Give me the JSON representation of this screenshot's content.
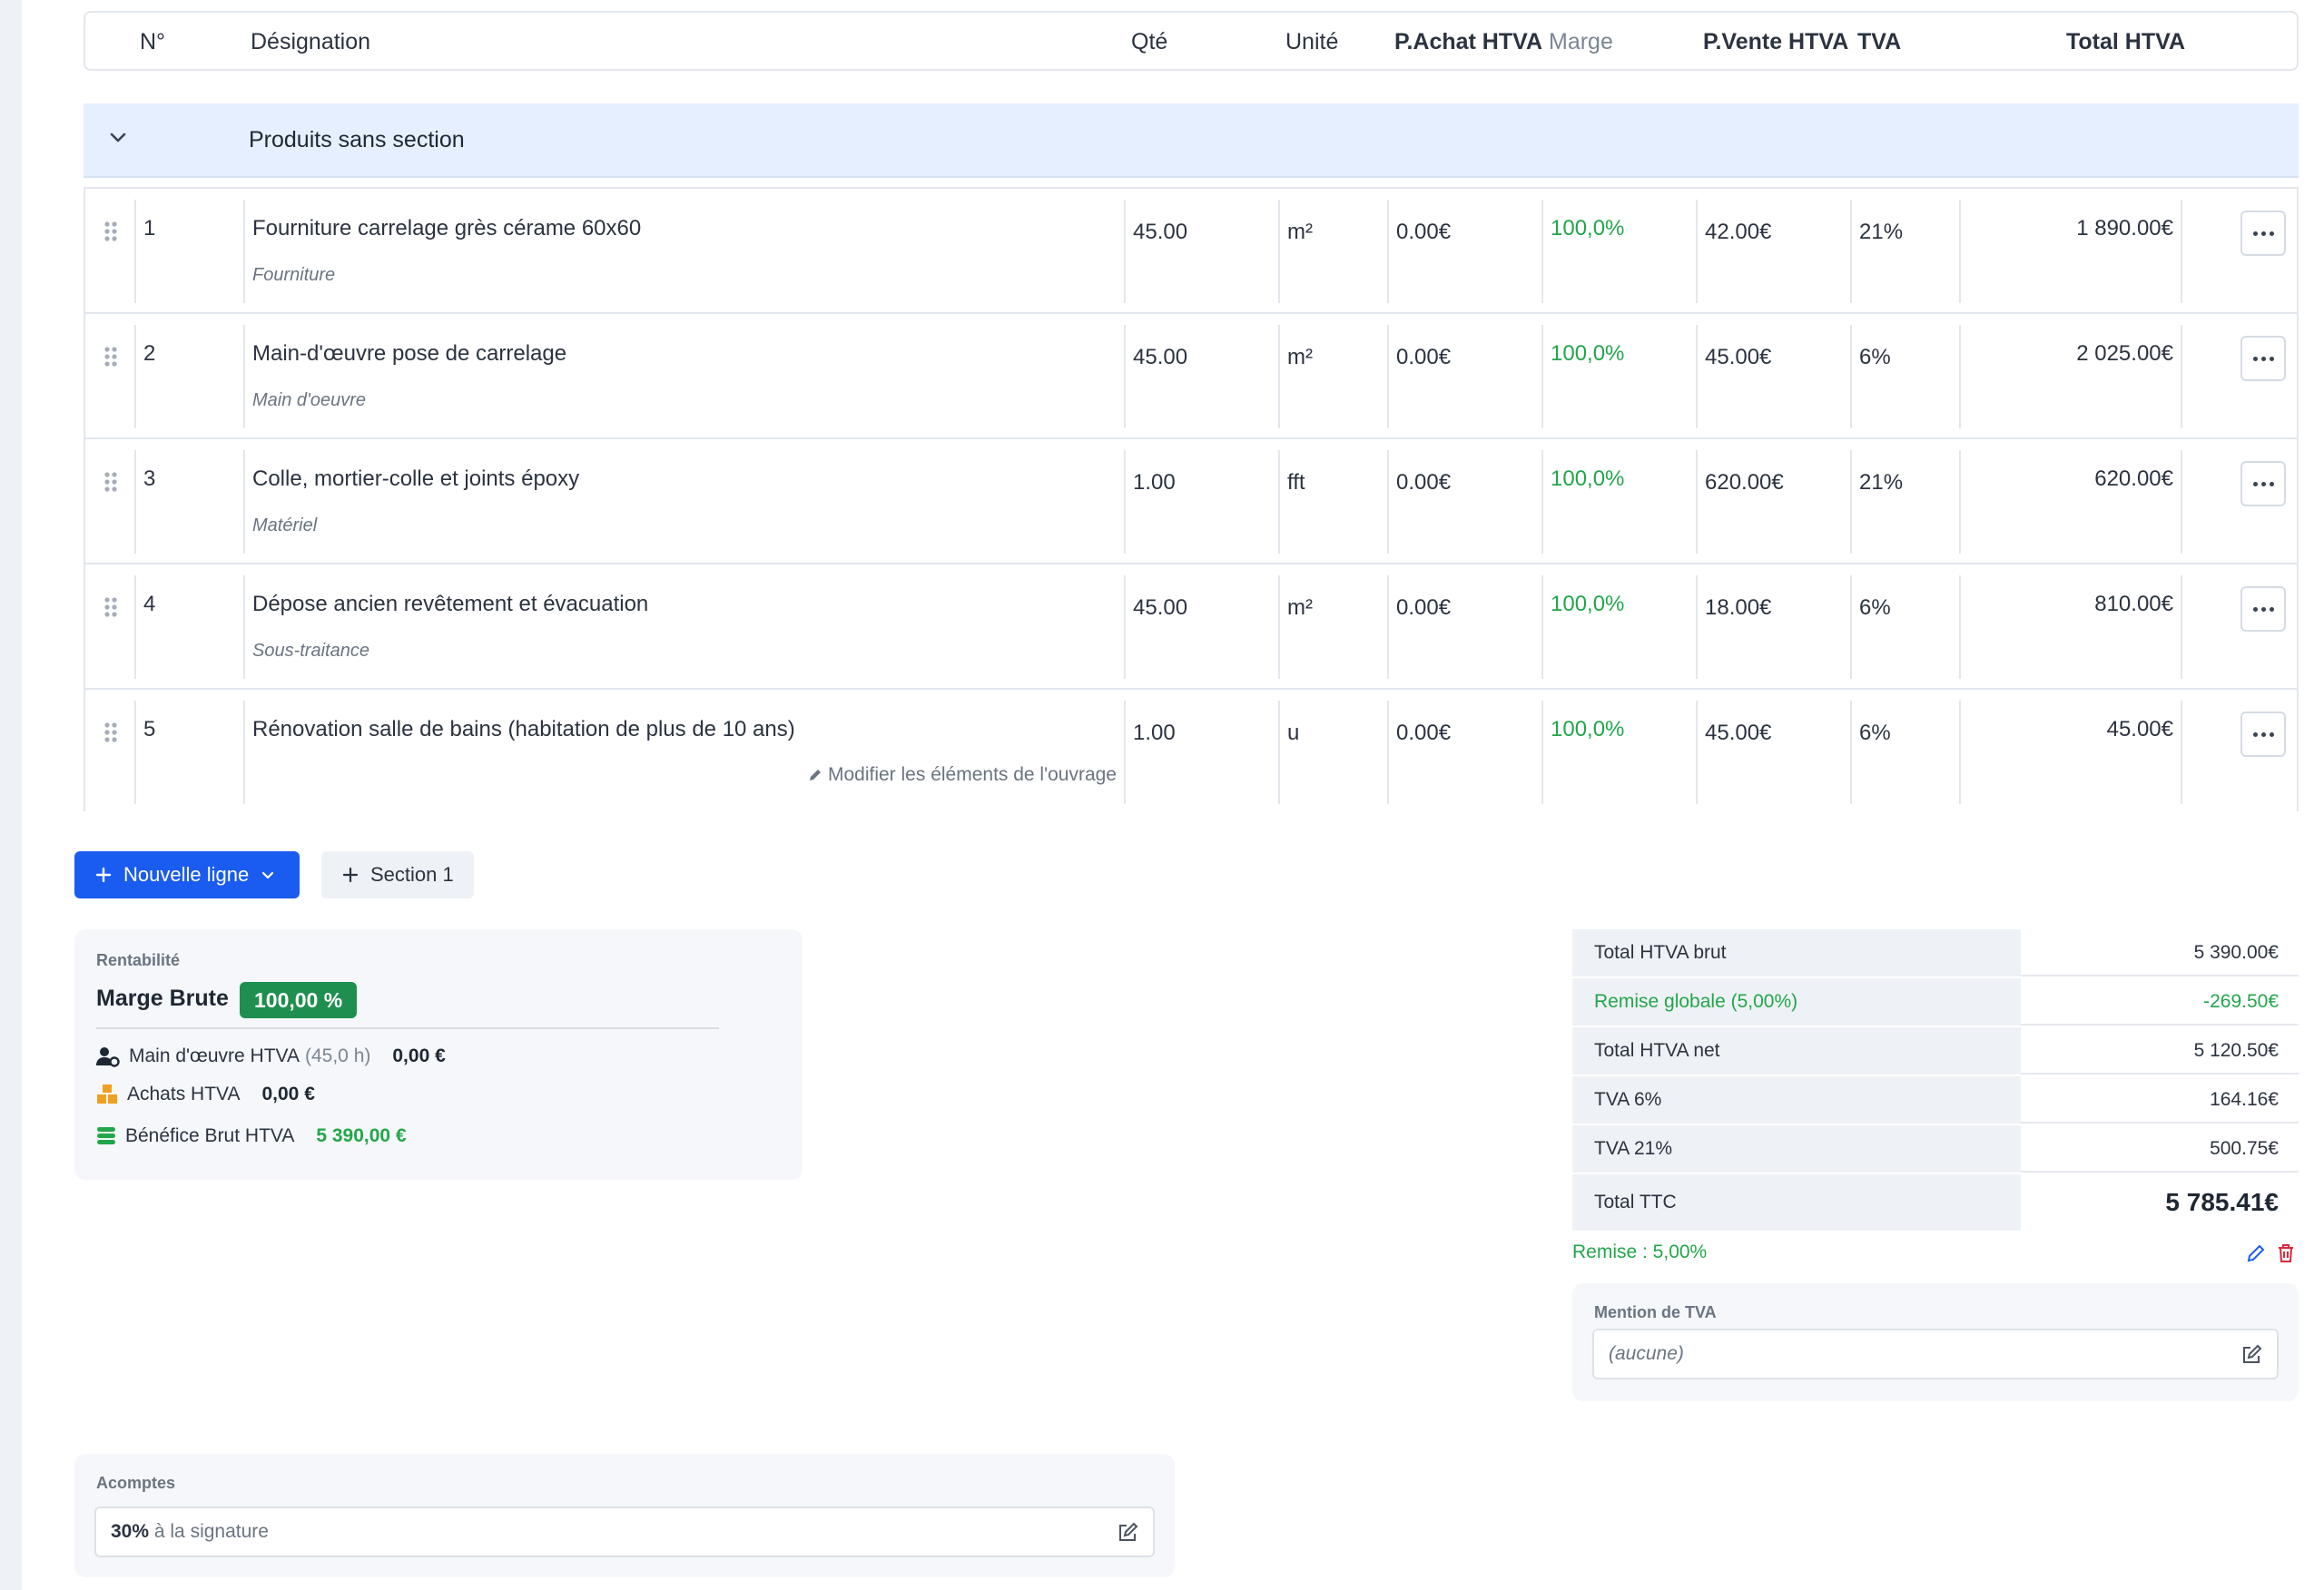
{
  "header": {
    "num": "N°",
    "designation": "Désignation",
    "qte": "Qté",
    "unite": "Unité",
    "pachat": "P.Achat HTVA",
    "marge": "Marge",
    "pvente": "P.Vente HTVA",
    "tva": "TVA",
    "total": "Total HTVA"
  },
  "section": {
    "title": "Produits sans section"
  },
  "rows": [
    {
      "num": "1",
      "desc": "Fourniture carrelage grès cérame 60x60",
      "sub": "Fourniture",
      "qte": "45.00",
      "unite": "m²",
      "pachat": "0.00€",
      "marge": "100,0%",
      "pvente": "42.00€",
      "tva": "21%",
      "total": "1 890.00€"
    },
    {
      "num": "2",
      "desc": "Main-d'œuvre pose de carrelage",
      "sub": "Main d'oeuvre",
      "qte": "45.00",
      "unite": "m²",
      "pachat": "0.00€",
      "marge": "100,0%",
      "pvente": "45.00€",
      "tva": "6%",
      "total": "2 025.00€"
    },
    {
      "num": "3",
      "desc": "Colle, mortier-colle et joints époxy",
      "sub": "Matériel",
      "qte": "1.00",
      "unite": "fft",
      "pachat": "0.00€",
      "marge": "100,0%",
      "pvente": "620.00€",
      "tva": "21%",
      "total": "620.00€"
    },
    {
      "num": "4",
      "desc": "Dépose ancien revêtement et évacuation",
      "sub": "Sous-traitance",
      "qte": "45.00",
      "unite": "m²",
      "pachat": "0.00€",
      "marge": "100,0%",
      "pvente": "18.00€",
      "tva": "6%",
      "total": "810.00€"
    },
    {
      "num": "5",
      "desc": "Rénovation salle de bains (habitation de plus de 10 ans)",
      "sub": "",
      "edit_link": "Modifier les éléments de l'ouvrage",
      "qte": "1.00",
      "unite": "u",
      "pachat": "0.00€",
      "marge": "100,0%",
      "pvente": "45.00€",
      "tva": "6%",
      "total": "45.00€"
    }
  ],
  "actions": {
    "new_line": "Nouvelle ligne",
    "section": "Section 1"
  },
  "profitability": {
    "title": "Rentabilité",
    "marge_label": "Marge Brute",
    "marge_value": "100,00 %",
    "labor_label": "Main d'œuvre HTVA",
    "labor_hours": "(45,0 h)",
    "labor_value": "0,00 €",
    "purchases_label": "Achats HTVA",
    "purchases_value": "0,00 €",
    "profit_label": "Bénéfice Brut HTVA",
    "profit_value": "5 390,00 €"
  },
  "totals": {
    "brut_label": "Total HTVA brut",
    "brut": "5 390.00€",
    "remise_label": "Remise globale (5,00%)",
    "remise": "-269.50€",
    "net_label": "Total HTVA net",
    "net": "5 120.50€",
    "tva6_label": "TVA 6%",
    "tva6": "164.16€",
    "tva21_label": "TVA 21%",
    "tva21": "500.75€",
    "ttc_label": "Total TTC",
    "ttc": "5 785.41€"
  },
  "remise_note": "Remise : 5,00%",
  "tva_mention": {
    "title": "Mention de TVA",
    "value": "(aucune)"
  },
  "acomptes": {
    "title": "Acomptes",
    "percent": "30%",
    "text": "à la signature"
  },
  "colors": {
    "primary": "#1a5cf0",
    "green": "#22a64a",
    "badge": "#1e8f4e",
    "section_bg": "#e5efff",
    "delete": "#e0263a"
  }
}
